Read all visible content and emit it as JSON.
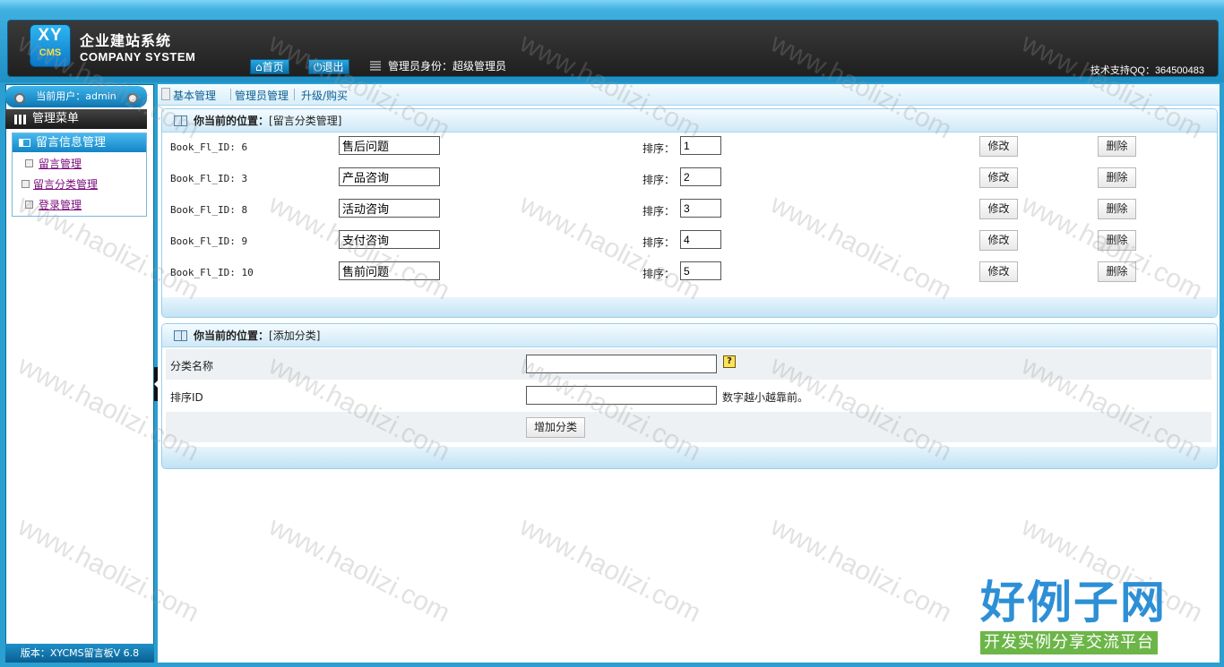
{
  "header": {
    "logo_top": "XY",
    "logo_bottom": "CMS",
    "brand_cn": "企业建站系统",
    "brand_en": "COMPANY SYSTEM",
    "home_label": "首页",
    "logout_label": "退出",
    "admin_role": "管理员身份：超级管理员",
    "support": "技术支持QQ：364500483"
  },
  "sidebar": {
    "current_user": "当前用户：admin",
    "menu_title": "管理菜单",
    "group_title": "留言信息管理",
    "items": [
      {
        "label": "留言管理"
      },
      {
        "label": "留言分类管理"
      },
      {
        "label": "登录管理"
      }
    ],
    "version": "版本：XYCMS留言板V 6.8"
  },
  "topnav": {
    "items": [
      {
        "label": "基本管理"
      },
      {
        "label": "管理员管理"
      },
      {
        "label": "升级/购买"
      }
    ]
  },
  "category_panel": {
    "location_label": "你当前的位置：",
    "location_value": "[留言分类管理]",
    "sort_label": "排序：",
    "edit_label": "修改",
    "delete_label": "删除",
    "rows": [
      {
        "id_text": "Book_Fl_ID: 6",
        "name": "售后问题",
        "sort": "1"
      },
      {
        "id_text": "Book_Fl_ID: 3",
        "name": "产品咨询",
        "sort": "2"
      },
      {
        "id_text": "Book_Fl_ID: 8",
        "name": "活动咨询",
        "sort": "3"
      },
      {
        "id_text": "Book_Fl_ID: 9",
        "name": "支付咨询",
        "sort": "4"
      },
      {
        "id_text": "Book_Fl_ID: 10",
        "name": "售前问题",
        "sort": "5"
      }
    ]
  },
  "add_panel": {
    "location_label": "你当前的位置：",
    "location_value": "[添加分类]",
    "name_label": "分类名称",
    "help_symbol": "?",
    "sort_label": "排序ID",
    "sort_hint": "数字越小越靠前。",
    "submit_label": "增加分类",
    "name_value": "",
    "sort_value": ""
  },
  "watermark": {
    "text": "www.haolizi.com",
    "brand_big": "好例子网",
    "brand_small": "开发实例分享交流平台"
  }
}
